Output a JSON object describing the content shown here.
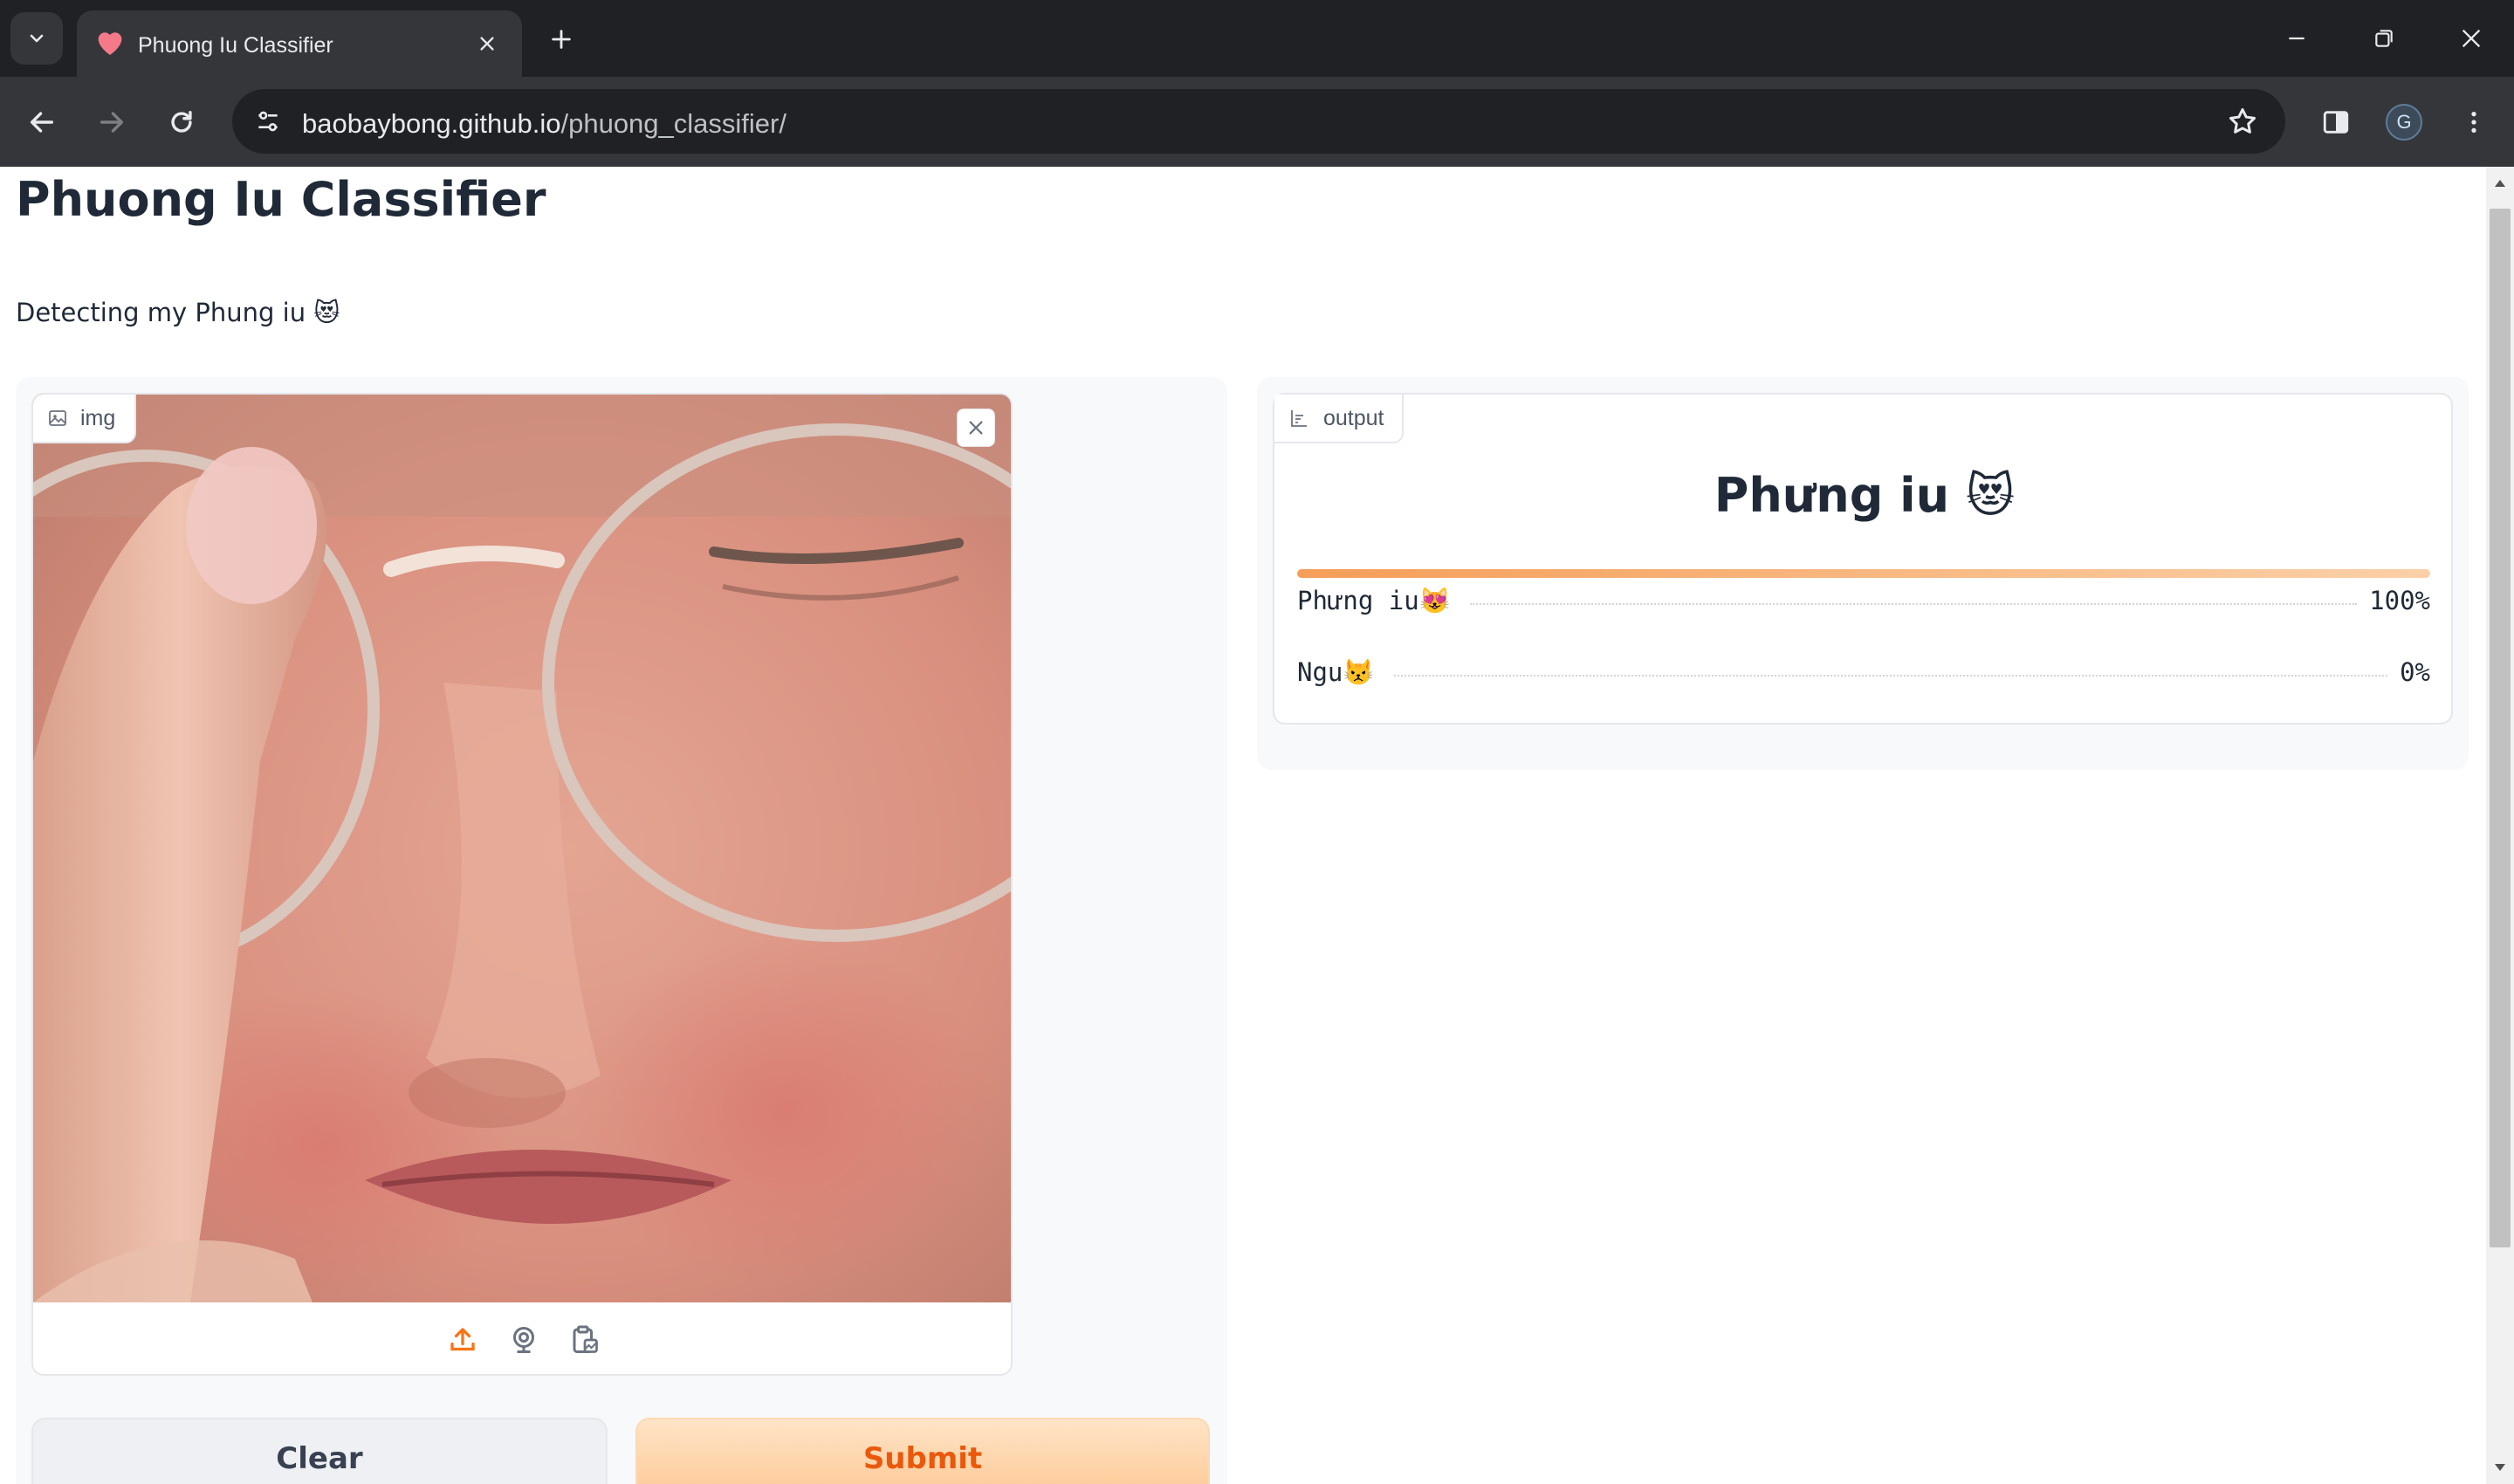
{
  "browser": {
    "tab_title": "Phuong Iu Classifier",
    "url_host": "baobaybong.github.io",
    "url_path": "/phuong_classifier/",
    "profile_initial": "G"
  },
  "page": {
    "title": "Phuong Iu Classifier",
    "description": "Detecting my Phung iu 😻"
  },
  "input": {
    "label": "img",
    "tools": [
      "upload-icon",
      "webcam-icon",
      "clipboard-icon"
    ]
  },
  "buttons": {
    "clear": "Clear",
    "submit": "Submit"
  },
  "output": {
    "label": "output",
    "top_label": "Phưng iu 😻",
    "confidences": [
      {
        "label": "Phưng iu😻",
        "percent": "100%",
        "value": 1.0
      },
      {
        "label": "Ngu😾",
        "percent": "0%",
        "value": 0.0
      }
    ]
  },
  "colors": {
    "accent": "#ea580c",
    "bar_start": "#f59e58",
    "bar_end": "#fbd0a8"
  }
}
